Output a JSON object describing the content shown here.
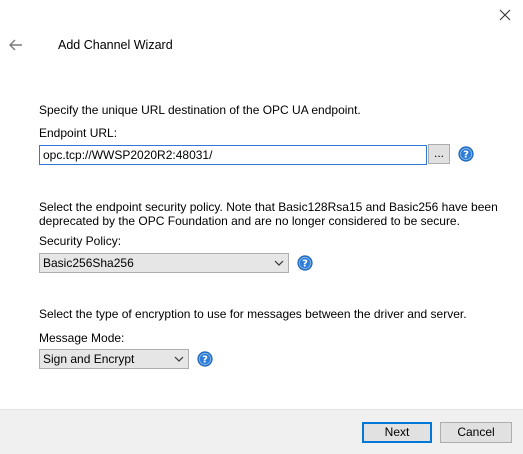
{
  "window": {
    "title": "Add Channel Wizard"
  },
  "icons": {
    "close": "close-icon",
    "back": "back-arrow-icon",
    "help": "help-icon",
    "browse": "ellipsis"
  },
  "endpoint": {
    "description": "Specify the unique URL destination of the OPC UA endpoint.",
    "label": "Endpoint URL:",
    "value": "opc.tcp://WWSP2020R2:48031/",
    "browse_label": "..."
  },
  "security": {
    "description_line1": "Select the endpoint security policy. Note that Basic128Rsa15 and Basic256 have been",
    "description_line2": "deprecated by the OPC Foundation and are no longer considered to be secure.",
    "label": "Security Policy:",
    "selected": "Basic256Sha256"
  },
  "message": {
    "description": "Select the type of encryption to use for messages between the driver and server.",
    "label": "Message Mode:",
    "selected": "Sign and Encrypt"
  },
  "footer": {
    "next_label": "Next",
    "cancel_label": "Cancel"
  },
  "colors": {
    "accent": "#0078d7",
    "help_blue": "#2f7ed8",
    "footer_bg": "#f0f0f0"
  }
}
